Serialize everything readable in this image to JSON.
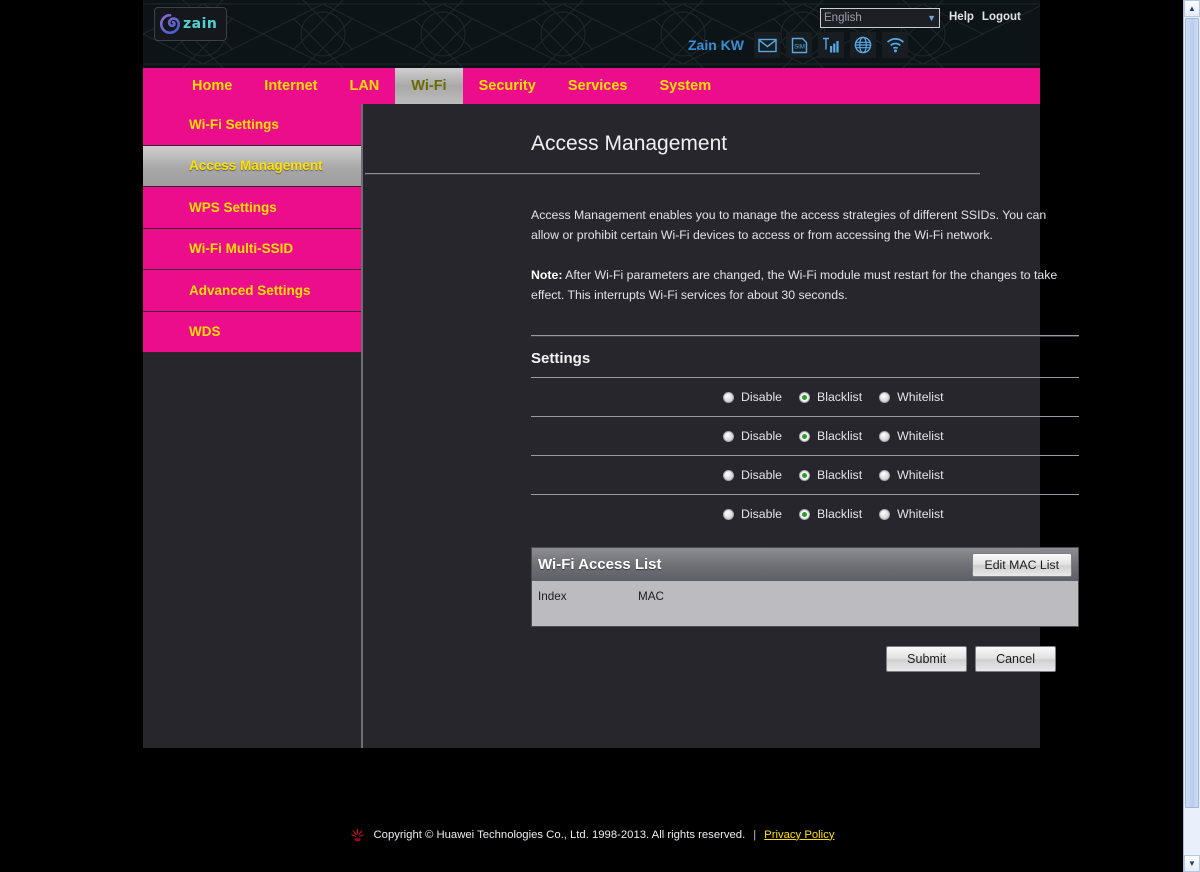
{
  "header": {
    "logo_text": "zain",
    "logo_icon": "zain-swirl-logo",
    "language": {
      "value": "English",
      "chevron": "chevron-down-icon"
    },
    "help_label": "Help",
    "logout_label": "Logout",
    "operator": "Zain KW",
    "status_icons": [
      {
        "name": "message-icon",
        "title": "Messages"
      },
      {
        "name": "sim-card-icon",
        "title": "SIM"
      },
      {
        "name": "signal-bars-icon",
        "title": "Signal"
      },
      {
        "name": "globe-icon",
        "title": "Internet"
      },
      {
        "name": "wifi-icon",
        "title": "Wi-Fi"
      }
    ]
  },
  "nav": {
    "items": [
      {
        "label": "Home",
        "active": false
      },
      {
        "label": "Internet",
        "active": false
      },
      {
        "label": "LAN",
        "active": false
      },
      {
        "label": "Wi-Fi",
        "active": true
      },
      {
        "label": "Security",
        "active": false
      },
      {
        "label": "Services",
        "active": false
      },
      {
        "label": "System",
        "active": false
      }
    ]
  },
  "sidebar": {
    "items": [
      {
        "label": "Wi-Fi Settings",
        "active": false
      },
      {
        "label": "Access Management",
        "active": true
      },
      {
        "label": "WPS Settings",
        "active": false
      },
      {
        "label": "Wi-Fi Multi-SSID",
        "active": false
      },
      {
        "label": "Advanced Settings",
        "active": false
      },
      {
        "label": "WDS",
        "active": false
      }
    ]
  },
  "main": {
    "title": "Access Management",
    "intro_paragraph": "Access Management enables you to manage the access strategies of different SSIDs. You can allow or prohibit certain Wi-Fi devices to access or from accessing the Wi-Fi network.",
    "note_label": "Note:",
    "note_text": " After Wi-Fi parameters are changed, the Wi-Fi module must restart for the changes to take effect. This interrupts Wi-Fi services for about 30 seconds.",
    "settings_title": "Settings",
    "radio_options": [
      "Disable",
      "Blacklist",
      "Whitelist"
    ],
    "radio_rows": [
      {
        "label": "",
        "selected": "Blacklist"
      },
      {
        "label": "",
        "selected": "Blacklist"
      },
      {
        "label": "",
        "selected": "Blacklist"
      },
      {
        "label": "",
        "selected": "Blacklist"
      }
    ],
    "access_list": {
      "title": "Wi-Fi Access List",
      "edit_button": "Edit MAC List",
      "columns": [
        "Index",
        "MAC"
      ],
      "rows": []
    },
    "submit_label": "Submit",
    "cancel_label": "Cancel"
  },
  "footer": {
    "logo_icon": "huawei-logo",
    "copyright": "Copyright © Huawei Technologies Co., Ltd. 1998-2013. All rights reserved.",
    "separator": "|",
    "privacy_link": "Privacy Policy"
  },
  "scrollbar": {
    "up_arrow": "▲",
    "down_arrow": "▼"
  },
  "colors": {
    "brand_magenta": "#ec0d8c",
    "nav_text_yellow": "#ffe000",
    "panel_bg": "#26262c",
    "header_bg": "#0d1417",
    "radio_selected_green": "#2f9e2f",
    "operator_blue": "#3a8fd4"
  }
}
